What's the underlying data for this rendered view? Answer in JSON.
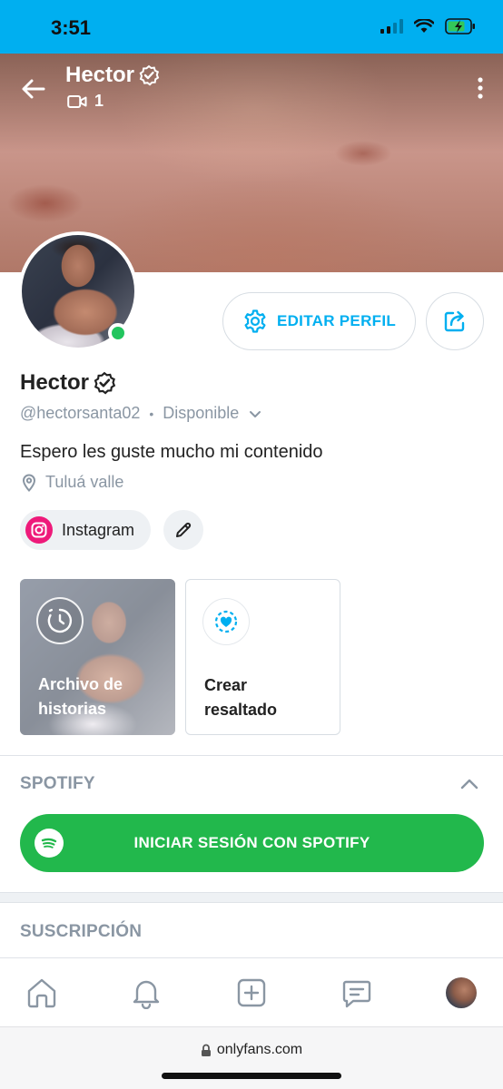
{
  "status_bar": {
    "time": "3:51"
  },
  "header": {
    "name": "Hector",
    "video_count": "1"
  },
  "actions": {
    "edit_profile_label": "EDITAR PERFIL"
  },
  "profile": {
    "name": "Hector",
    "handle": "@hectorsanta02",
    "separator": "•",
    "status": "Disponible",
    "bio": "Espero les guste mucho mi contenido",
    "location": "Tuluá valle",
    "social_link": "Instagram"
  },
  "highlights": {
    "archive_label": "Archivo de historias",
    "create_label": "Crear resaltado"
  },
  "spotify": {
    "section_title": "SPOTIFY",
    "login_label": "INICIAR SESIÓN CON SPOTIFY"
  },
  "subscription": {
    "section_title": "SUSCRIPCIÓN"
  },
  "browser": {
    "url": "onlyfans.com"
  },
  "colors": {
    "accent": "#00aff0",
    "online": "#22c55e",
    "spotify": "#22b84c",
    "instagram": "#ee1a7a",
    "muted": "#8a96a3"
  },
  "icons": [
    "back-arrow-icon",
    "verified-badge-icon",
    "video-icon",
    "more-vert-icon",
    "settings-gear-icon",
    "share-icon",
    "chevron-down-icon",
    "location-pin-icon",
    "instagram-icon",
    "pencil-icon",
    "clock-history-icon",
    "heart-highlight-icon",
    "chevron-up-icon",
    "spotify-icon",
    "home-icon",
    "bell-icon",
    "add-post-icon",
    "messages-icon",
    "lock-icon"
  ]
}
